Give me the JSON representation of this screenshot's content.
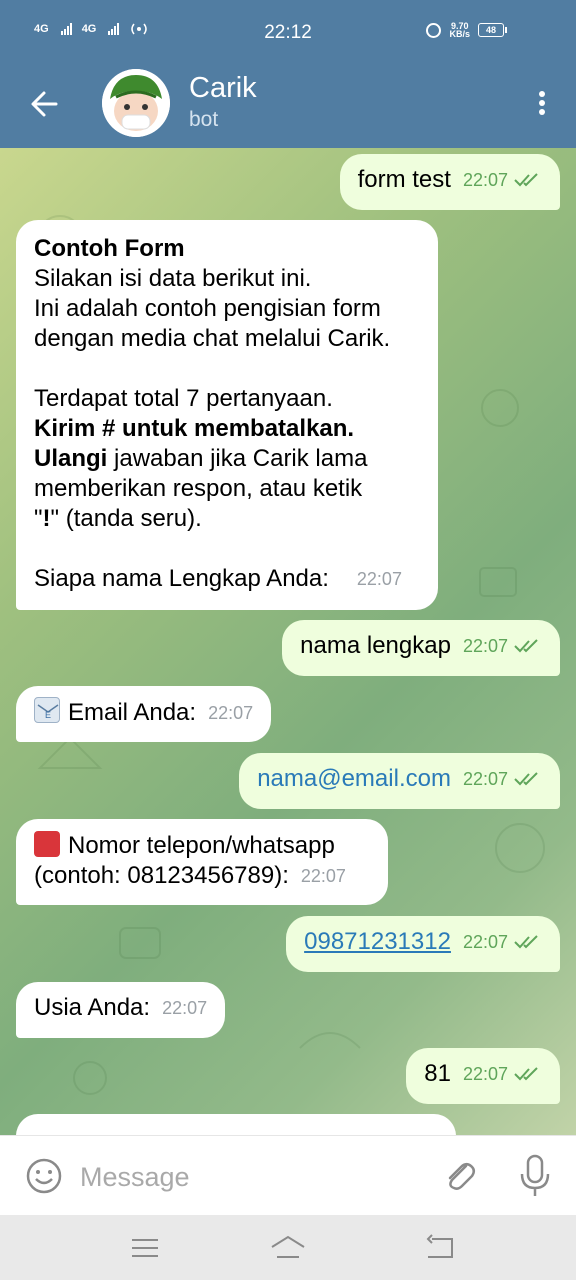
{
  "status_bar": {
    "net1": "4G",
    "net2": "4G",
    "time": "22:12",
    "speed": "9.70",
    "speed_unit": "KB/s",
    "battery": "48"
  },
  "header": {
    "title": "Carik",
    "subtitle": "bot"
  },
  "messages": [
    {
      "text": "form test",
      "time": "22:07"
    },
    {
      "title": "Contoh Form",
      "line1": "Silakan isi data berikut ini.",
      "line2": "Ini adalah contoh pengisian form",
      "line3": "dengan media chat melalui Carik.",
      "line4": "Terdapat total 7 pertanyaan.",
      "line5_bold": "Kirim # untuk membatalkan.",
      "line6_bold": "Ulangi",
      "line6_rest": " jawaban jika Carik lama",
      "line7": "memberikan respon, atau ketik",
      "line8_q1": "\"",
      "line8_bold": "!",
      "line8_q2": "\" (tanda seru).",
      "line9": "Siapa nama Lengkap Anda:",
      "time": "22:07"
    },
    {
      "text": "nama lengkap",
      "time": "22:07"
    },
    {
      "text": "Email Anda:",
      "time": "22:07"
    },
    {
      "text": "nama@email.com",
      "time": "22:07"
    },
    {
      "line1": "Nomor telepon/whatsapp",
      "line2": "(contoh: 08123456789):",
      "time": "22:07"
    },
    {
      "text": "09871231312",
      "time": "22:07"
    },
    {
      "text": "Usia Anda:",
      "time": "22:07"
    },
    {
      "text": "81",
      "time": "22:07"
    }
  ],
  "input": {
    "placeholder": "Message"
  }
}
